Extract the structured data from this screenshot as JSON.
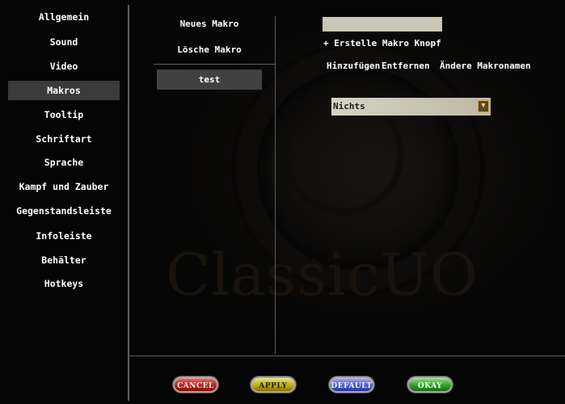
{
  "sidebar": {
    "items": [
      {
        "label": "Allgemein",
        "active": false
      },
      {
        "label": "Sound",
        "active": false
      },
      {
        "label": "Video",
        "active": false
      },
      {
        "label": "Makros",
        "active": true
      },
      {
        "label": "Tooltip",
        "active": false
      },
      {
        "label": "Schriftart",
        "active": false
      },
      {
        "label": "Sprache",
        "active": false
      },
      {
        "label": "Kampf und Zauber",
        "active": false
      },
      {
        "label": "Gegenstandsleiste",
        "active": false
      },
      {
        "label": "Infoleiste",
        "active": false
      },
      {
        "label": "Behälter",
        "active": false
      },
      {
        "label": "Hotkeys",
        "active": false
      }
    ]
  },
  "macros": {
    "new_label": "Neues Makro",
    "delete_label": "Lösche Makro",
    "list": [
      "test"
    ]
  },
  "editor": {
    "name_value": "",
    "create_button_label": "+ Erstelle Makro Knopf",
    "add_label": "Hinzufügen",
    "remove_label": "Entfernen",
    "rename_label": "Ändere Makronamen",
    "action_selected": "Nichts",
    "dropdown_arrow_icon": "chevron-down-icon"
  },
  "background": {
    "watermark": "ClassicUO"
  },
  "footer": {
    "cancel_label": "CANCEL",
    "apply_label": "APPLY",
    "default_label": "DEFAULT",
    "okay_label": "OKAY"
  },
  "colors": {
    "background": "#050505",
    "text": "#ffffff",
    "active_item": "#3b3b3b",
    "divider": "#5d5d5d",
    "cancel": "#b41f1f",
    "apply": "#b7a913",
    "default": "#4b5ac8",
    "okay": "#2f9a2c"
  }
}
